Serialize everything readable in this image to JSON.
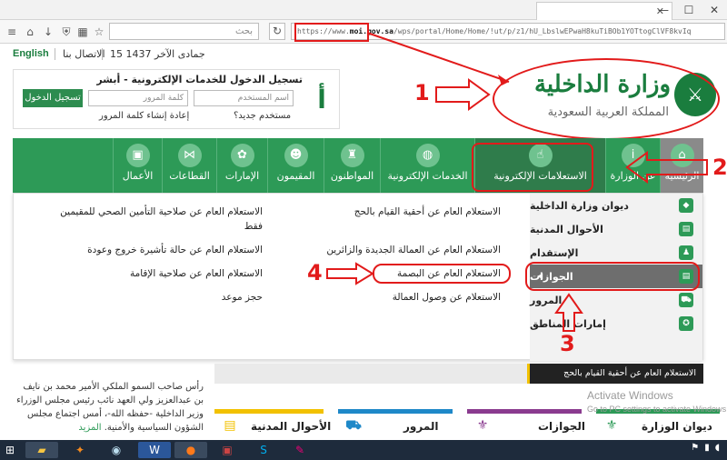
{
  "browser": {
    "tab_title": "",
    "search_placeholder": "بحث",
    "url_prefix": "https://www.",
    "url_domain": "moi.gov.sa",
    "url_rest": "/wps/portal/Home/Home/!ut/p/z1/hU_LbslwEPwaH8kuTiBOb1YOTtogClVF8kvIq",
    "reload_icon": "reload-icon",
    "win_min": "—",
    "win_max": "☐",
    "win_close": "✕"
  },
  "topbar": {
    "language": "English",
    "contact": "الاتصال بنا",
    "date": "15 جمادى الآخر 1437"
  },
  "login": {
    "title": "تسجيل الدخول للخدمات الإلكترونية - أبشر",
    "username_placeholder": "اسم المستخدم",
    "password_placeholder": "كلمة المرور",
    "login_button": "تسجيل الدخول",
    "new_user": "مستخدم جديد؟",
    "create_password": "إعادة إنشاء كلمة المرور",
    "logo_glyph": "أبشر"
  },
  "ministry": {
    "name": "وزارة الداخلية",
    "subtitle": "المملكة العربية السعودية"
  },
  "nav": {
    "items": [
      {
        "label": "الرئيسية",
        "icon": "🏠"
      },
      {
        "label": "عن الوزارة",
        "icon": "ℹ"
      },
      {
        "label": "الاستعلامات الإلكترونية",
        "icon": "☝"
      },
      {
        "label": "الخدمات الإلكترونية",
        "icon": "🌐"
      },
      {
        "label": "المواطنون",
        "icon": "♜"
      },
      {
        "label": "المقيمون",
        "icon": "👥"
      },
      {
        "label": "الإمارات",
        "icon": "✿"
      },
      {
        "label": "القطاعات",
        "icon": "⋈"
      },
      {
        "label": "الأعمال",
        "icon": "💼"
      }
    ]
  },
  "side_menu": {
    "items": [
      {
        "label": "ديوان وزارة الداخلية",
        "icon": "◆"
      },
      {
        "label": "الأحوال المدنية",
        "icon": "▤"
      },
      {
        "label": "الإستقدام",
        "icon": "♟"
      },
      {
        "label": "الجوازات",
        "icon": "▤"
      },
      {
        "label": "المرور",
        "icon": "⛟"
      },
      {
        "label": "إمارات المناطق",
        "icon": "✪"
      }
    ]
  },
  "queries": {
    "col1": [
      "الاستعلام العام عن أحقية القيام بالحج",
      "الاستعلام العام عن العمالة الجديدة والزائرين",
      "الاستعلام العام عن البصمة",
      "الاستعلام عن وصول العمالة"
    ],
    "col2": [
      "الاستعلام العام عن صلاحية التأمين الصحي للمقيمين",
      "فقط",
      "الاستعلام العام عن حالة تأشيرة خروج وعودة",
      "الاستعلام العام عن صلاحية الإقامة",
      "حجز موعد"
    ]
  },
  "annotations": {
    "n1": "1",
    "n2": "2",
    "n3": "3",
    "n4": "4"
  },
  "news": {
    "text": "رأس صاحب السمو الملكي الأمير محمد بن نايف بن عبدالعزيز ولي العهد نائب رئيس مجلس الوزراء وزير الداخلية -حفظه الله-، أمس اجتماع مجلس الشؤون السياسية والأمنية.",
    "more": "المزيد",
    "ticker": "الاستعلام العام عن أحقية القيام بالحج"
  },
  "bottom": {
    "items": [
      {
        "label": "الأحوال المدنية",
        "icon": "▤",
        "color": "#f2c100"
      },
      {
        "label": "المرور",
        "icon": "⛟",
        "color": "#1e88c8"
      },
      {
        "label": "الجوازات",
        "icon": "⚜",
        "color": "#8a3b8f"
      },
      {
        "label": "ديوان الوزارة",
        "icon": "⚜",
        "color": "#2d9a57"
      }
    ]
  },
  "watermark": {
    "title": "Activate Windows",
    "sub": "Go to PC settings to activate Windows"
  },
  "taskbar": {
    "icons": [
      "start-icon",
      "folder-icon",
      "media-icon",
      "chrome-icon",
      "word-icon",
      "firefox-icon",
      "app-icon",
      "skype-icon",
      "paint-icon"
    ]
  },
  "colors": {
    "brand_green": "#2d9a57",
    "annotation_red": "#e21b1b"
  }
}
